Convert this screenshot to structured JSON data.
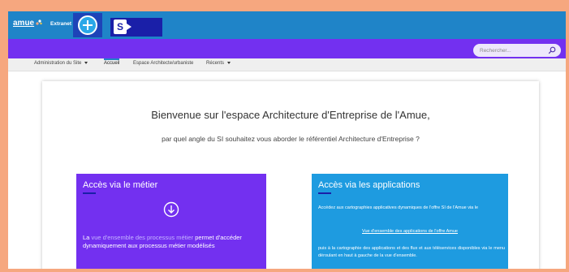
{
  "suitebar": {
    "brand": "amue",
    "site_label": "Extranet"
  },
  "search": {
    "placeholder": "Rechercher..."
  },
  "nav": {
    "items": [
      {
        "label": "Administration du Site",
        "dropdown": true
      },
      {
        "label": "Accueil",
        "active": true
      },
      {
        "label": "Espace Architecte/urbaniste"
      },
      {
        "label": "Récents",
        "dropdown": true
      }
    ]
  },
  "main": {
    "headline": "Bienvenue sur l'espace Architecture d'Entreprise de l'Amue,",
    "subline": "par quel angle du SI souhaitez vous aborder le référentiel Architecture d'Entreprise ?",
    "left_panel": {
      "title": "Accès via le métier",
      "text_prefix": "La ",
      "text_highlight": "vue d'ensemble des processus métier",
      "text_suffix": " permet d'accéder dynamiquement aux processus métier modélisés"
    },
    "right_panel": {
      "title": "Accès via les applications",
      "intro": "Accédez aux cartographies applicatives dynamiques de l'offre SI de l'Amue via le",
      "link": "Vue d'ensemble des applications de l'offre Amue",
      "body": "puis à la cartographie des applications et des flux et aux téléservices disponibles via le menu déroulant en haut à gauche de la vue d'ensemble."
    }
  },
  "colors": {
    "page_border": "#f6a77f",
    "suitebar": "#1f84c8",
    "band": "#7330f0",
    "left_panel": "#7330f0",
    "right_panel": "#1e9be0"
  }
}
